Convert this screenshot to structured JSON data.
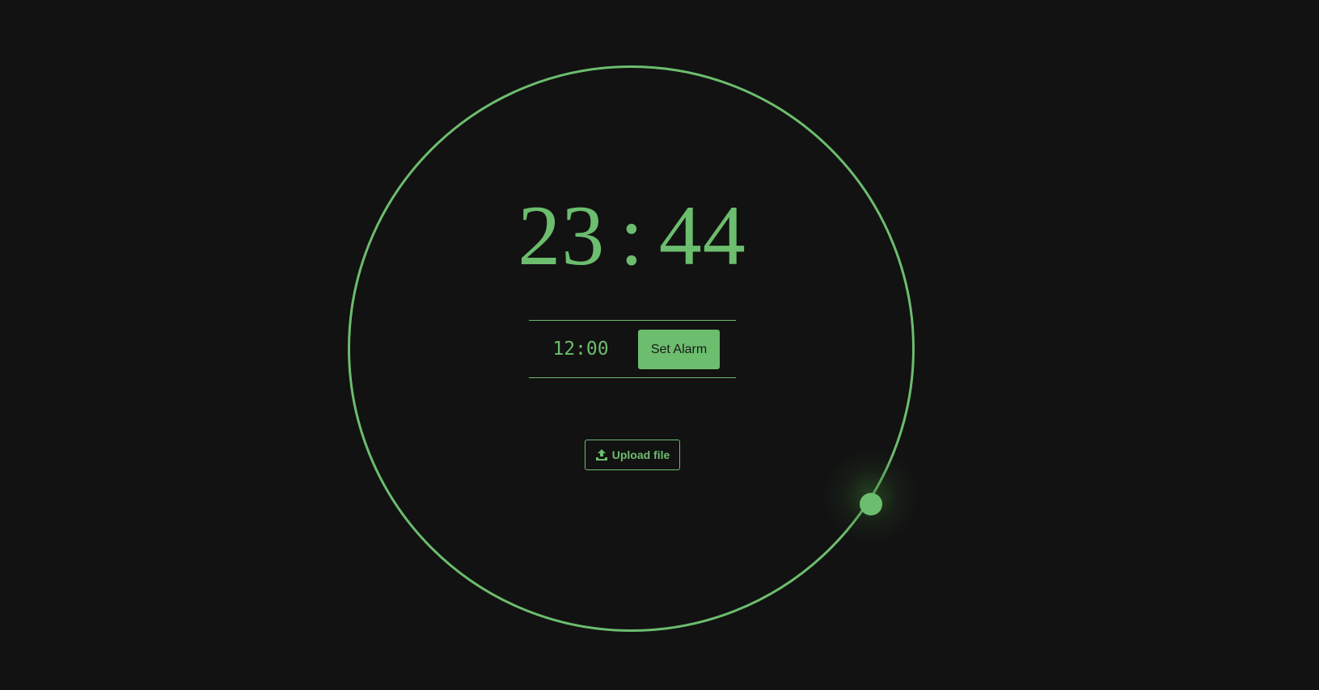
{
  "clock": {
    "hours": "23",
    "separator": ":",
    "minutes": "44"
  },
  "alarm": {
    "time_value": "12:00",
    "set_label": "Set Alarm"
  },
  "upload": {
    "icon": "upload-icon",
    "label": "Upload file"
  },
  "colors": {
    "accent": "#6cbd6e",
    "background": "#121212"
  }
}
